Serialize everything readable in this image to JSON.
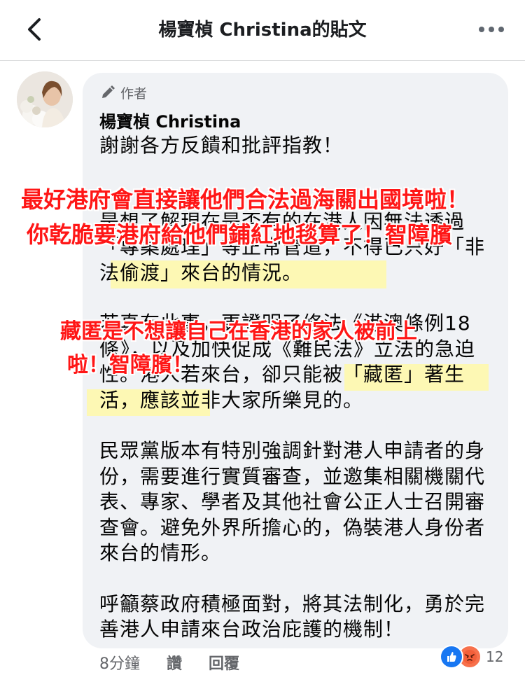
{
  "header": {
    "title": "楊寶楨 Christina的貼文"
  },
  "post": {
    "author_badge": "作者",
    "author_name": "楊寶楨 Christina",
    "paragraphs": [
      "謝謝各方反饋和批評指教！",
      "",
      "是想了解現在是否有的在港人因無法透過「專案處理」等正常管道，不得已只好「非法偷渡」來台的情況。",
      "",
      "若真有此事，更證明了修法《港澳條例18條》，以及加快促成《難民法》立法的急迫性。港人若來台，卻只能被「藏匿」著生活，應該並非大家所樂見的。",
      "",
      "民眾黨版本有特別強調針對港人申請者的身份，需要進行實質審查，並邀集相關機關代表、專家、學者及其他社會公正人士召開審查會。避免外界所擔心的，偽裝港人身份者來台的情形。",
      "",
      "呼籲蔡政府積極面對，將其法制化，勇於完善港人申請來台政治庇護的機制！"
    ]
  },
  "overlays": {
    "line1": "最好港府會直接讓他們合法過海關出國境啦！",
    "line2": "你乾脆要港府給他們鋪紅地毯算了！智障臏",
    "line3": "藏匿是不想讓自己在香港的家人被前上",
    "line4": "啦！智障臏！"
  },
  "footer": {
    "time": "8分鐘",
    "like": "讚",
    "reply": "回覆",
    "reaction_count": "12"
  },
  "colors": {
    "overlay_red": "#ff1616",
    "highlight_yellow": "#fff9a8",
    "bubble_bg": "#f0f2f5",
    "like_blue": "#1877f2",
    "angry_orange": "#f7714c"
  }
}
